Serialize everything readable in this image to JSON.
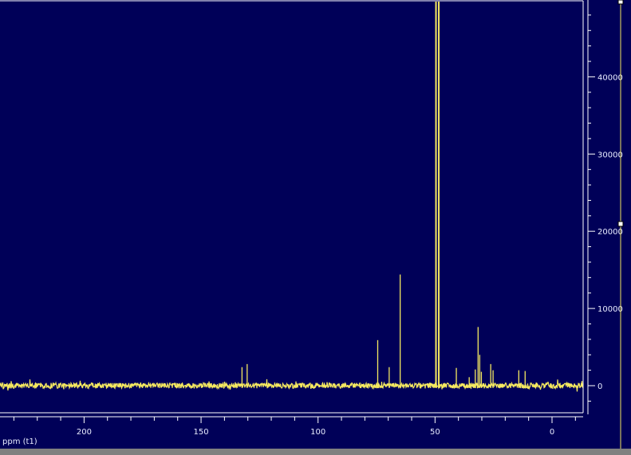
{
  "chart_data": {
    "type": "line",
    "xlabel": "ppm (t1)",
    "ylabel": "",
    "x_reversed": true,
    "xlim": [
      236,
      -13
    ],
    "ylim": [
      -3500,
      50000
    ],
    "x_ticks": [
      "200",
      "150",
      "100",
      "50",
      "0"
    ],
    "x_tick_values": [
      200,
      150,
      100,
      50,
      0
    ],
    "y_ticks": [
      "0",
      "10000",
      "20000",
      "30000",
      "40000"
    ],
    "y_tick_values": [
      0,
      10000,
      20000,
      30000,
      40000
    ],
    "grid": false,
    "colors": {
      "background": "#000058",
      "trace": "#f5e960",
      "axis": "#ffffff"
    },
    "peaks": [
      {
        "ppm": 132.5,
        "intensity": 2400
      },
      {
        "ppm": 130.3,
        "intensity": 2800
      },
      {
        "ppm": 74.5,
        "intensity": 5900
      },
      {
        "ppm": 69.6,
        "intensity": 2400
      },
      {
        "ppm": 64.9,
        "intensity": 14400
      },
      {
        "ppm": 49.6,
        "intensity": 50000
      },
      {
        "ppm": 48.4,
        "intensity": 50000
      },
      {
        "ppm": 40.9,
        "intensity": 2300
      },
      {
        "ppm": 35.4,
        "intensity": 1100
      },
      {
        "ppm": 32.8,
        "intensity": 2100
      },
      {
        "ppm": 31.6,
        "intensity": 7600
      },
      {
        "ppm": 30.9,
        "intensity": 4000
      },
      {
        "ppm": 30.2,
        "intensity": 1800
      },
      {
        "ppm": 26.2,
        "intensity": 2800
      },
      {
        "ppm": 25.2,
        "intensity": 2000
      },
      {
        "ppm": 14.2,
        "intensity": 2000
      },
      {
        "ppm": 11.5,
        "intensity": 1900
      }
    ]
  }
}
